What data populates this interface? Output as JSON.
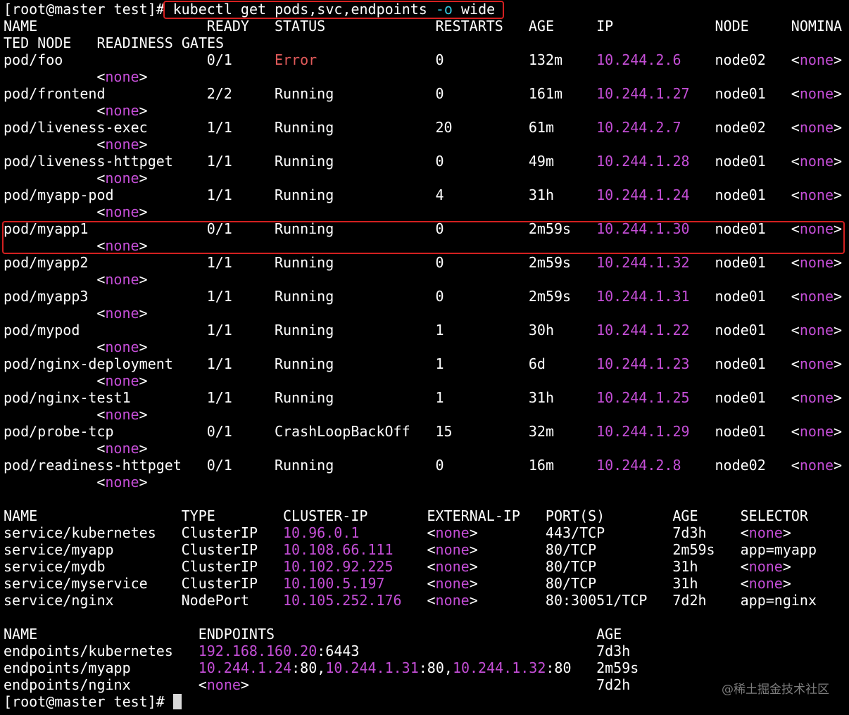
{
  "prompt_user": "[root@master test]#",
  "command": {
    "part1": "kubectl get pods,svc,endpoints ",
    "flag": "-o",
    "part2": " wide"
  },
  "pods": {
    "headers": [
      "NAME",
      "READY",
      "STATUS",
      "RESTARTS",
      "AGE",
      "IP",
      "NODE",
      "NOMINA"
    ],
    "header_wrap": "TED NODE   READINESS GATES",
    "rows": [
      {
        "name": "pod/foo",
        "ready": "0/1",
        "status": "Error",
        "restarts": "0",
        "age": "132m",
        "ip": "10.244.2.6",
        "node": "node02",
        "nominated": "<none>",
        "gates": "<none>"
      },
      {
        "name": "pod/frontend",
        "ready": "2/2",
        "status": "Running",
        "restarts": "0",
        "age": "161m",
        "ip": "10.244.1.27",
        "node": "node01",
        "nominated": "<none>",
        "gates": "<none>"
      },
      {
        "name": "pod/liveness-exec",
        "ready": "1/1",
        "status": "Running",
        "restarts": "20",
        "age": "61m",
        "ip": "10.244.2.7",
        "node": "node02",
        "nominated": "<none>",
        "gates": "<none>"
      },
      {
        "name": "pod/liveness-httpget",
        "ready": "1/1",
        "status": "Running",
        "restarts": "0",
        "age": "49m",
        "ip": "10.244.1.28",
        "node": "node01",
        "nominated": "<none>",
        "gates": "<none>"
      },
      {
        "name": "pod/myapp-pod",
        "ready": "1/1",
        "status": "Running",
        "restarts": "4",
        "age": "31h",
        "ip": "10.244.1.24",
        "node": "node01",
        "nominated": "<none>",
        "gates": "<none>"
      },
      {
        "name": "pod/myapp1",
        "ready": "0/1",
        "status": "Running",
        "restarts": "0",
        "age": "2m59s",
        "ip": "10.244.1.30",
        "node": "node01",
        "nominated": "<none>",
        "gates": "<none>"
      },
      {
        "name": "pod/myapp2",
        "ready": "1/1",
        "status": "Running",
        "restarts": "0",
        "age": "2m59s",
        "ip": "10.244.1.32",
        "node": "node01",
        "nominated": "<none>",
        "gates": "<none>"
      },
      {
        "name": "pod/myapp3",
        "ready": "1/1",
        "status": "Running",
        "restarts": "0",
        "age": "2m59s",
        "ip": "10.244.1.31",
        "node": "node01",
        "nominated": "<none>",
        "gates": "<none>"
      },
      {
        "name": "pod/mypod",
        "ready": "1/1",
        "status": "Running",
        "restarts": "1",
        "age": "30h",
        "ip": "10.244.1.22",
        "node": "node01",
        "nominated": "<none>",
        "gates": "<none>"
      },
      {
        "name": "pod/nginx-deployment",
        "ready": "1/1",
        "status": "Running",
        "restarts": "1",
        "age": "6d",
        "ip": "10.244.1.23",
        "node": "node01",
        "nominated": "<none>",
        "gates": "<none>"
      },
      {
        "name": "pod/nginx-test1",
        "ready": "1/1",
        "status": "Running",
        "restarts": "1",
        "age": "31h",
        "ip": "10.244.1.25",
        "node": "node01",
        "nominated": "<none>",
        "gates": "<none>"
      },
      {
        "name": "pod/probe-tcp",
        "ready": "0/1",
        "status": "CrashLoopBackOff",
        "restarts": "15",
        "age": "32m",
        "ip": "10.244.1.29",
        "node": "node01",
        "nominated": "<none>",
        "gates": "<none>"
      },
      {
        "name": "pod/readiness-httpget",
        "ready": "0/1",
        "status": "Running",
        "restarts": "0",
        "age": "16m",
        "ip": "10.244.2.8",
        "node": "node02",
        "nominated": "<none>",
        "gates": "<none>"
      }
    ]
  },
  "services": {
    "headers": [
      "NAME",
      "TYPE",
      "CLUSTER-IP",
      "EXTERNAL-IP",
      "PORT(S)",
      "AGE",
      "SELECTOR"
    ],
    "rows": [
      {
        "name": "service/kubernetes",
        "type": "ClusterIP",
        "cluster_ip": "10.96.0.1",
        "external_ip": "<none>",
        "ports": "443/TCP",
        "age": "7d3h",
        "selector": "<none>"
      },
      {
        "name": "service/myapp",
        "type": "ClusterIP",
        "cluster_ip": "10.108.66.111",
        "external_ip": "<none>",
        "ports": "80/TCP",
        "age": "2m59s",
        "selector": "app=myapp"
      },
      {
        "name": "service/mydb",
        "type": "ClusterIP",
        "cluster_ip": "10.102.92.225",
        "external_ip": "<none>",
        "ports": "80/TCP",
        "age": "31h",
        "selector": "<none>"
      },
      {
        "name": "service/myservice",
        "type": "ClusterIP",
        "cluster_ip": "10.100.5.197",
        "external_ip": "<none>",
        "ports": "80/TCP",
        "age": "31h",
        "selector": "<none>"
      },
      {
        "name": "service/nginx",
        "type": "NodePort",
        "cluster_ip": "10.105.252.176",
        "external_ip": "<none>",
        "ports": "80:30051/TCP",
        "age": "7d2h",
        "selector": "app=nginx"
      }
    ]
  },
  "endpoints": {
    "headers": [
      "NAME",
      "ENDPOINTS",
      "AGE"
    ],
    "rows": [
      {
        "name": "endpoints/kubernetes",
        "parts": [
          {
            "ip": "192.168.160.20",
            "port": ":6443"
          }
        ],
        "age": "7d3h"
      },
      {
        "name": "endpoints/myapp",
        "parts": [
          {
            "ip": "10.244.1.24",
            "port": ":80,"
          },
          {
            "ip": "10.244.1.31",
            "port": ":80,"
          },
          {
            "ip": "10.244.1.32",
            "port": ":80"
          }
        ],
        "age": "2m59s"
      },
      {
        "name": "endpoints/nginx",
        "none": "<none>",
        "age": "7d2h"
      }
    ]
  },
  "watermark": "@稀土掘金技术社区",
  "colors": {
    "ip": "#c44ed6",
    "error": "#e15a5a",
    "flag": "#33c6dd",
    "highlight": "#d32020"
  }
}
